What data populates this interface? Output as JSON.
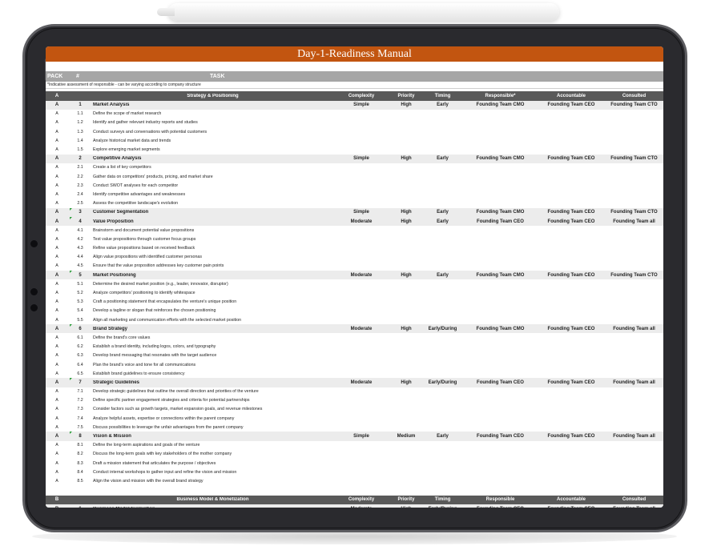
{
  "title": "Day-1-Readiness Manual",
  "header": {
    "pack": "PACK",
    "num": "#",
    "task": "TASK"
  },
  "note": "*Indicative assessment of responsible - can be varying according to company structure",
  "sections": [
    {
      "pack": "A",
      "title": "Strategy & Positioning",
      "columns": [
        "Complexity",
        "Priority",
        "Timing",
        "Responsible*",
        "Accountable",
        "Consulted"
      ],
      "groups": [
        {
          "num": "1",
          "title": "Market Analysis",
          "complexity": "Simple",
          "priority": "High",
          "timing": "Early",
          "responsible": "Founding Team CMO",
          "accountable": "Founding Team CEO",
          "consulted": "Founding Team CTO",
          "flag": false,
          "tasks": [
            {
              "num": "1.1",
              "text": "Define the scope of market research"
            },
            {
              "num": "1.2",
              "text": "Identify and gather relevant industry reports and studies"
            },
            {
              "num": "1.3",
              "text": "Conduct surveys and conversations with potential customers"
            },
            {
              "num": "1.4",
              "text": "Analyze historical market data and trends"
            },
            {
              "num": "1.5",
              "text": "Explore emerging market segments"
            }
          ]
        },
        {
          "num": "2",
          "title": "Competitive Analysis",
          "complexity": "Simple",
          "priority": "High",
          "timing": "Early",
          "responsible": "Founding Team CMO",
          "accountable": "Founding Team CEO",
          "consulted": "Founding Team CTO",
          "flag": false,
          "tasks": [
            {
              "num": "2.1",
              "text": "Create a list of key competitors"
            },
            {
              "num": "2.2",
              "text": "Gather data on competitors' products, pricing, and market share"
            },
            {
              "num": "2.3",
              "text": "Conduct SWOT analyses for each competitor"
            },
            {
              "num": "2.4",
              "text": "Identify competitive advantages and weaknesses"
            },
            {
              "num": "2.5",
              "text": "Assess the competitive landscape's evolution"
            }
          ]
        },
        {
          "num": "3",
          "title": "Customer Segmentation",
          "complexity": "Simple",
          "priority": "High",
          "timing": "Early",
          "responsible": "Founding Team CMO",
          "accountable": "Founding Team CEO",
          "consulted": "Founding Team CTO",
          "flag": true,
          "tasks": []
        },
        {
          "num": "4",
          "title": "Value Proposition",
          "complexity": "Moderate",
          "priority": "High",
          "timing": "Early",
          "responsible": "Founding Team CEO",
          "accountable": "Founding Team CEO",
          "consulted": "Founding Team all",
          "flag": true,
          "tasks": [
            {
              "num": "4.1",
              "text": "Brainstorm and document potential value propositions"
            },
            {
              "num": "4.2",
              "text": "Test value propositions through customer focus groups"
            },
            {
              "num": "4.3",
              "text": "Refine value propositions based on received feedback"
            },
            {
              "num": "4.4",
              "text": "Align value propositions with identified customer personas"
            },
            {
              "num": "4.5",
              "text": "Ensure that the value proposition addresses key customer pain points"
            }
          ]
        },
        {
          "num": "5",
          "title": "Market Positioning",
          "complexity": "Moderate",
          "priority": "High",
          "timing": "Early",
          "responsible": "Founding Team CMO",
          "accountable": "Founding Team CEO",
          "consulted": "Founding Team CTO",
          "flag": true,
          "tasks": [
            {
              "num": "5.1",
              "text": "Determine the desired market position (e.g., leader, innovator, disruptor)"
            },
            {
              "num": "5.2",
              "text": "Analyze competitors' positioning to identify whitespace"
            },
            {
              "num": "5.3",
              "text": "Craft a positioning statement that encapsulates the venture's unique position"
            },
            {
              "num": "5.4",
              "text": "Develop a tagline or slogan that reinforces the chosen positioning"
            },
            {
              "num": "5.5",
              "text": "Align all marketing and communication efforts with the selected market position"
            }
          ]
        },
        {
          "num": "6",
          "title": "Brand Strategy",
          "complexity": "Moderate",
          "priority": "High",
          "timing": "Early/During",
          "responsible": "Founding Team CMO",
          "accountable": "Founding Team CEO",
          "consulted": "Founding Team all",
          "flag": true,
          "tasks": [
            {
              "num": "6.1",
              "text": "Define the brand's core values"
            },
            {
              "num": "6.2",
              "text": "Establish a brand identity, including logos, colors, and typography"
            },
            {
              "num": "6.3",
              "text": "Develop brand messaging that resonates with the target audience"
            },
            {
              "num": "6.4",
              "text": "Plan the brand's voice and tone for all communications"
            },
            {
              "num": "6.5",
              "text": "Establish brand guidelines to ensure consistency"
            }
          ]
        },
        {
          "num": "7",
          "title": "Strategic Guidelines",
          "complexity": "Moderate",
          "priority": "High",
          "timing": "Early/During",
          "responsible": "Founding Team CEO",
          "accountable": "Founding Team CEO",
          "consulted": "Founding Team all",
          "flag": true,
          "tasks": [
            {
              "num": "7.1",
              "text": "Develop strategic guidelines that outline the overall direction and priorities of the venture"
            },
            {
              "num": "7.2",
              "text": "Define specific partner engagement strategies and criteria for potential partnerships"
            },
            {
              "num": "7.3",
              "text": "Consider factors such as growth targets, market expansion goals, and revenue milestones"
            },
            {
              "num": "7.4",
              "text": "Analyze helpful assets, expertise or connections within the parent company"
            },
            {
              "num": "7.5",
              "text": "Discuss possibilities to leverage the unfair advantages from the parent company"
            }
          ]
        },
        {
          "num": "8",
          "title": "Vision & Mission",
          "complexity": "Simple",
          "priority": "Medium",
          "timing": "Early",
          "responsible": "Founding Team CEO",
          "accountable": "Founding Team CEO",
          "consulted": "Founding Team all",
          "flag": true,
          "tasks": [
            {
              "num": "8.1",
              "text": "Define the long-term aspirations and goals of the venture"
            },
            {
              "num": "8.2",
              "text": "Discuss the long-term goals with key stakeholders of the mother company"
            },
            {
              "num": "8.3",
              "text": "Draft a mission statement that articulates the purpose / objectives"
            },
            {
              "num": "8.4",
              "text": "Conduct internal workshops to gather input and refine the vision and mission"
            },
            {
              "num": "8.5",
              "text": "Align the vision and mission with the overall brand strategy"
            }
          ]
        }
      ]
    },
    {
      "pack": "B",
      "title": "Business Model & Monetization",
      "columns": [
        "Complexity",
        "Priority",
        "Timing",
        "Responsible",
        "Accountable",
        "Consulted"
      ],
      "groups": [
        {
          "num": "1",
          "title": "Business Model Evaluation",
          "complexity": "Moderate",
          "priority": "High",
          "timing": "Early/During",
          "responsible": "Founding Team CEO",
          "accountable": "Founding Team CEO",
          "consulted": "Founding Team all",
          "flag": false,
          "tasks": []
        }
      ]
    }
  ]
}
